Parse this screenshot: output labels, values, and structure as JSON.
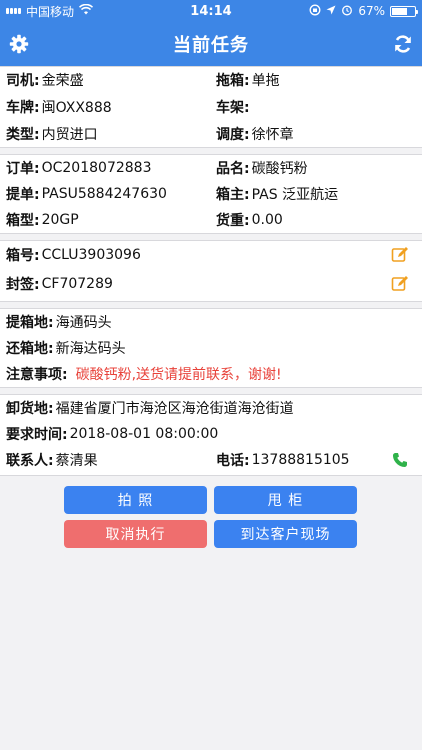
{
  "status_bar": {
    "carrier": "中国移动",
    "time": "14:14",
    "battery": "67%",
    "battery_level": 0.67
  },
  "nav": {
    "title": "当前任务",
    "left_icon": "gear-icon",
    "right_icon": "refresh-icon"
  },
  "driver_section": {
    "driver_label": "司机:",
    "driver_value": "金荣盛",
    "trailer_label": "拖箱:",
    "trailer_value": "单拖",
    "plate_label": "车牌:",
    "plate_value": "闽OXX888",
    "frame_label": "车架:",
    "frame_value": "",
    "type_label": "类型:",
    "type_value": "内贸进口",
    "dispatch_label": "调度:",
    "dispatch_value": "徐怀章"
  },
  "order_section": {
    "order_label": "订单:",
    "order_value": "OC2018072883",
    "product_label": "品名:",
    "product_value": "碳酸钙粉",
    "bill_label": "提单:",
    "bill_value": "PASU5884247630",
    "owner_label": "箱主:",
    "owner_value": "PAS 泛亚航运",
    "boxtype_label": "箱型:",
    "boxtype_value": "20GP",
    "weight_label": "货重:",
    "weight_value": "0.00"
  },
  "container_section": {
    "container_label": "箱号:",
    "container_value": "CCLU3903096",
    "seal_label": "封签:",
    "seal_value": "CF707289",
    "edit_icon": "edit-icon"
  },
  "location_section": {
    "pickup_label": "提箱地:",
    "pickup_value": "海通码头",
    "return_label": "还箱地:",
    "return_value": "新海达码头",
    "notice_label": "注意事项:",
    "notice_value": "碳酸钙粉,送货请提前联系，谢谢!"
  },
  "delivery_section": {
    "unload_label": "卸货地:",
    "unload_value": "福建省厦门市海沧区海沧街道海沧街道",
    "time_label": "要求时间:",
    "time_value": "2018-08-01 08:00:00",
    "contact_label": "联系人:",
    "contact_value": "蔡清果",
    "phone_label": "电话:",
    "phone_value": "13788815105",
    "phone_icon": "phone-icon"
  },
  "buttons": {
    "photo": "拍 照",
    "drop": "甩 柜",
    "cancel": "取消执行",
    "arrive": "到达客户现场"
  },
  "colors": {
    "primary": "#3d86e6",
    "button_blue": "#3b82f0",
    "button_red": "#ef6e6e",
    "notice_red": "#e8423a",
    "edit_orange": "#f0a020",
    "phone_green": "#2fb24a"
  }
}
